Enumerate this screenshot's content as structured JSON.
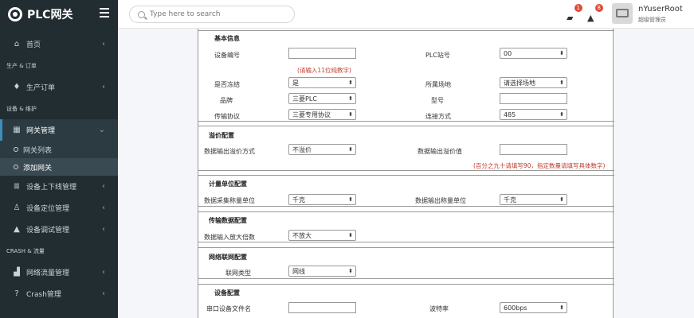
{
  "brand": {
    "title": "PLC网关"
  },
  "sidebar": {
    "home": "首页",
    "sec_production": "生产 & 订单",
    "orders": "生产订单",
    "sec_device": "设备 & 维护",
    "gateway": "网关管理",
    "gateway_list": "网关列表",
    "add_gateway": "添加网关",
    "device_updown": "设备上下线管理",
    "device_locate": "设备定位管理",
    "device_debug": "设备调试管理",
    "sec_crash": "CRASH & 流量",
    "traffic": "网络流量管理",
    "crash": "Crash管理"
  },
  "header": {
    "search_placeholder": "Type here to search",
    "messages_count": "1",
    "alerts_count": "8",
    "user_name": "nYuserRoot",
    "user_role": "超级管理员"
  },
  "form": {
    "basic": {
      "legend": "基本信息",
      "device_no_label": "设备编号",
      "device_no_value": "",
      "device_no_hint": "(请输入11位纯数字)",
      "plc_station_label": "PLC站号",
      "plc_station_value": "00",
      "frozen_label": "是否冻结",
      "frozen_value": "是",
      "site_label": "所属场地",
      "site_value": "请选择场地",
      "brand_label": "品牌",
      "brand_value": "三菱PLC",
      "model_label": "型号",
      "model_value": "",
      "protocol_label": "传输协议",
      "protocol_value": "三菱专用协议",
      "conn_label": "连接方式",
      "conn_value": "485"
    },
    "overflow": {
      "legend": "溢价配置",
      "mode_label": "数据输出溢价方式",
      "mode_value": "不溢价",
      "value_label": "数据输出溢价值",
      "value_value": "",
      "value_hint": "(百分之九十请填写90，指定数量请填写具体数字)"
    },
    "unit": {
      "legend": "计量单位配置",
      "collect_label": "数据采集称量单位",
      "collect_value": "千克",
      "output_label": "数据输出称量单位",
      "output_value": "千克"
    },
    "transfer": {
      "legend": "传输数据配置",
      "zoom_label": "数据输入放大倍数",
      "zoom_value": "不放大"
    },
    "network": {
      "legend": "网络联网配置",
      "type_label": "联网类型",
      "type_value": "网线"
    },
    "device": {
      "legend": "设备配置",
      "serial_label": "串口设备文件名",
      "serial_value": "",
      "baud_label": "波特率",
      "baud_value": "600bps"
    }
  }
}
